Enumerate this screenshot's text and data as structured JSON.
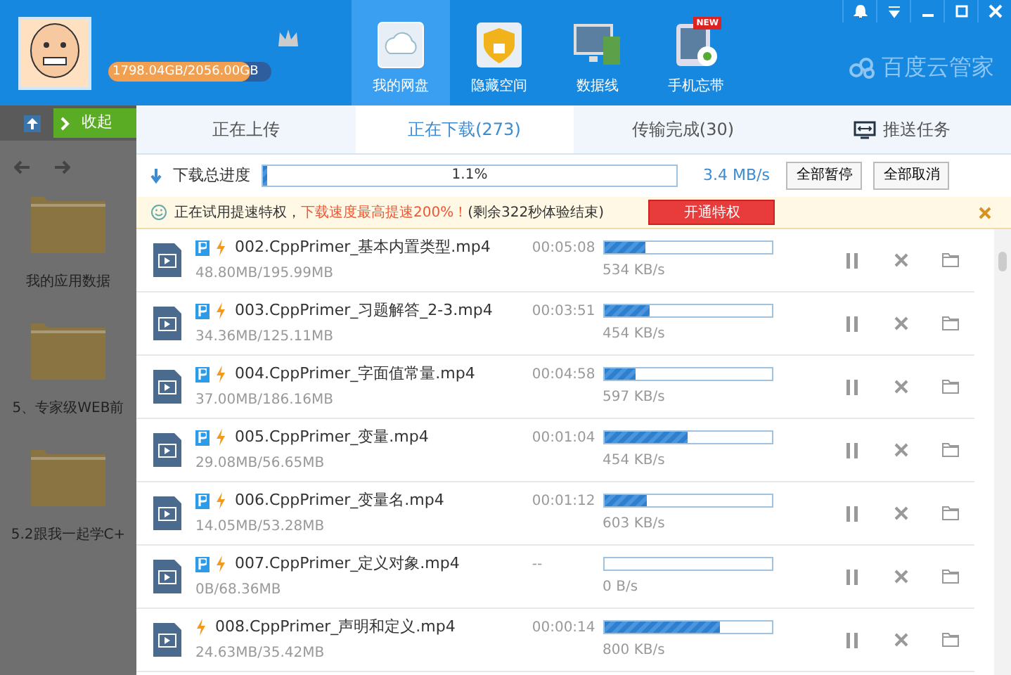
{
  "header": {
    "quota": {
      "reading": "1798.04GB/2056.00GB",
      "level": 0.87
    },
    "nav": [
      {
        "label": "我的网盘",
        "selected": true
      },
      {
        "label": "隐藏空间",
        "selected": false
      },
      {
        "label": "数据线",
        "selected": false
      },
      {
        "label": "手机忘带",
        "selected": false,
        "badge": "NEW"
      }
    ],
    "brand": "百度云管家"
  },
  "sidebar": {
    "collapse": "收起",
    "folders": [
      "我的应用数据",
      "5、专家级WEB前",
      "5.2跟我一起学C+"
    ]
  },
  "tabs": [
    {
      "label": "正在上传",
      "selected": false
    },
    {
      "label": "正在下载(273)",
      "selected": true
    },
    {
      "label": "传输完成(30)",
      "selected": false
    },
    {
      "label": "推送任务",
      "selected": false
    }
  ],
  "progress": {
    "label": "下载总进度",
    "level": 0.011,
    "reading": "1.1%",
    "speed": "3.4 MB/s",
    "buttons": [
      "全部暂停",
      "全部取消"
    ]
  },
  "notice": {
    "text": "正在试用提速特权，",
    "highlight": "下载速度最高提速200%！",
    "tail": "(剩余322秒体验结束)",
    "button": "开通特权"
  },
  "rows": [
    {
      "name": "002.CppPrimer_基本内置类型.mp4",
      "size": "48.80MB/195.99MB",
      "time": "00:05:08",
      "level": 0.25,
      "speed": "534 KB/s",
      "p_badge": true
    },
    {
      "name": "003.CppPrimer_习题解答_2-3.mp4",
      "size": "34.36MB/125.11MB",
      "time": "00:03:51",
      "level": 0.27,
      "speed": "454 KB/s",
      "p_badge": true
    },
    {
      "name": "004.CppPrimer_字面值常量.mp4",
      "size": "37.00MB/186.16MB",
      "time": "00:04:58",
      "level": 0.19,
      "speed": "597 KB/s",
      "p_badge": true
    },
    {
      "name": "005.CppPrimer_变量.mp4",
      "size": "29.08MB/56.65MB",
      "time": "00:01:04",
      "level": 0.5,
      "speed": "454 KB/s",
      "p_badge": true
    },
    {
      "name": "006.CppPrimer_变量名.mp4",
      "size": "14.05MB/53.28MB",
      "time": "00:01:12",
      "level": 0.26,
      "speed": "603 KB/s",
      "p_badge": true
    },
    {
      "name": "007.CppPrimer_定义对象.mp4",
      "size": "0B/68.36MB",
      "time": "--",
      "level": 0,
      "speed": "0 B/s",
      "p_badge": true
    },
    {
      "name": "008.CppPrimer_声明和定义.mp4",
      "size": "24.63MB/35.42MB",
      "time": "00:00:14",
      "level": 0.69,
      "speed": "800 KB/s",
      "p_badge": false
    }
  ]
}
